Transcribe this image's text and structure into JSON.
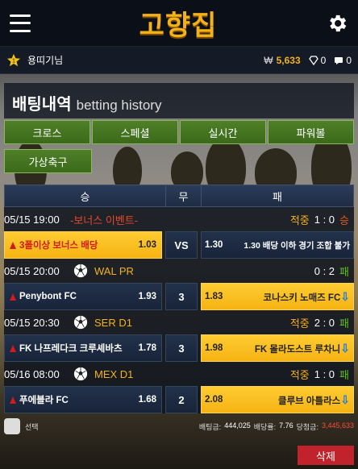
{
  "header": {
    "logo": "고향집"
  },
  "user": {
    "level": "1",
    "name": "용띠기님",
    "currency": "₩",
    "money": "5,633",
    "gems": "0",
    "messages": "0"
  },
  "page": {
    "title_ko": "배팅내역",
    "title_en": "betting history"
  },
  "tabs": [
    "크로스",
    "스페셜",
    "실시간",
    "파워볼"
  ],
  "tab_extra": "가상축구",
  "columns": {
    "win": "승",
    "draw": "무",
    "lose": "패"
  },
  "bets": [
    {
      "time": "05/15 19:00",
      "league": "-보너스 이벤트-",
      "league_color": "#e24a2a",
      "ball": false,
      "status": "적중",
      "score": "1 : 0",
      "outcome": "승",
      "home": "3폴이상 보너스 배당",
      "home_odds": "1.03",
      "draw": "VS",
      "away_odds": "1.30",
      "away": "1.30 배당 이하 경기 조합 불가",
      "sel": "home"
    },
    {
      "time": "05/15 20:00",
      "league": "WAL PR",
      "league_color": "#f3b21a",
      "ball": true,
      "status": "",
      "score": "0 : 2",
      "outcome": "패",
      "home": "Penybont FC",
      "home_odds": "1.93",
      "draw": "3",
      "away_odds": "1.83",
      "away": "코나스키 노매즈 FC",
      "sel": "away"
    },
    {
      "time": "05/15 20:30",
      "league": "SER D1",
      "league_color": "#f3b21a",
      "ball": true,
      "status": "적중",
      "score": "2 : 0",
      "outcome": "패",
      "home": "FK 나프레다크 크루셰바츠",
      "home_odds": "1.78",
      "draw": "3",
      "away_odds": "1.98",
      "away": "FK 몰라도스트 루차니",
      "sel": "away"
    },
    {
      "time": "05/16 08:00",
      "league": "MEX D1",
      "league_color": "#f3b21a",
      "ball": true,
      "status": "적중",
      "score": "1 : 0",
      "outcome": "패",
      "home": "푸에블라 FC",
      "home_odds": "1.68",
      "draw": "2",
      "away_odds": "2.08",
      "away": "클루브 아틀라스",
      "sel": "away"
    }
  ],
  "footer": {
    "select": "선택",
    "bet_amount_label": "배팅금:",
    "bet_amount": "444,025",
    "odds_label": "배당률:",
    "odds": "7.76",
    "win_label": "당첨금:",
    "win": "3,445,633"
  },
  "delete": "삭제"
}
